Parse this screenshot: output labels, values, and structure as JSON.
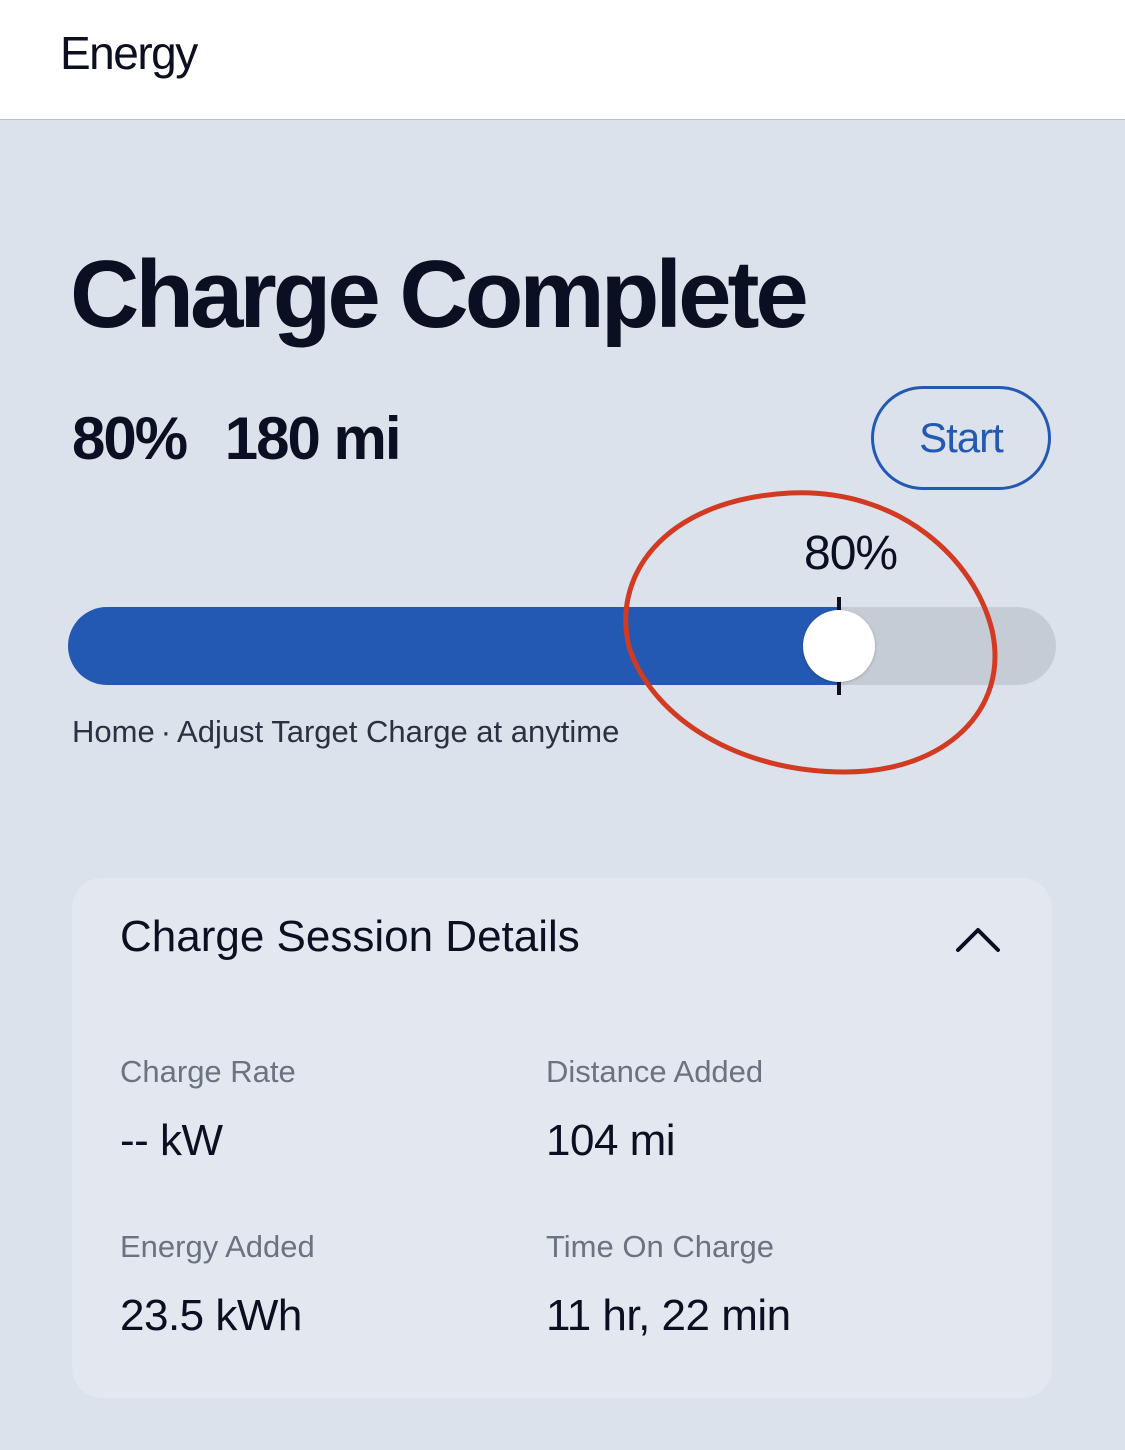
{
  "header": {
    "title": "Energy"
  },
  "status": {
    "title": "Charge Complete",
    "soc_percent": "80%",
    "range": "180 mi",
    "start_label": "Start"
  },
  "target_slider": {
    "value_label": "80%",
    "value_fraction": 0.78,
    "location": "Home",
    "separator": "·",
    "hint": "Adjust Target Charge at anytime"
  },
  "colors": {
    "accent": "#2459b3",
    "annotation": "#d23a22",
    "background": "#dbe2ec"
  },
  "details": {
    "title": "Charge Session Details",
    "collapse_icon": "chevron-up-icon",
    "metrics": [
      {
        "label": "Charge Rate",
        "value": "-- kW"
      },
      {
        "label": "Distance Added",
        "value": "104 mi"
      },
      {
        "label": "Energy Added",
        "value": "23.5 kWh"
      },
      {
        "label": "Time On Charge",
        "value": "11 hr, 22 min"
      }
    ]
  }
}
